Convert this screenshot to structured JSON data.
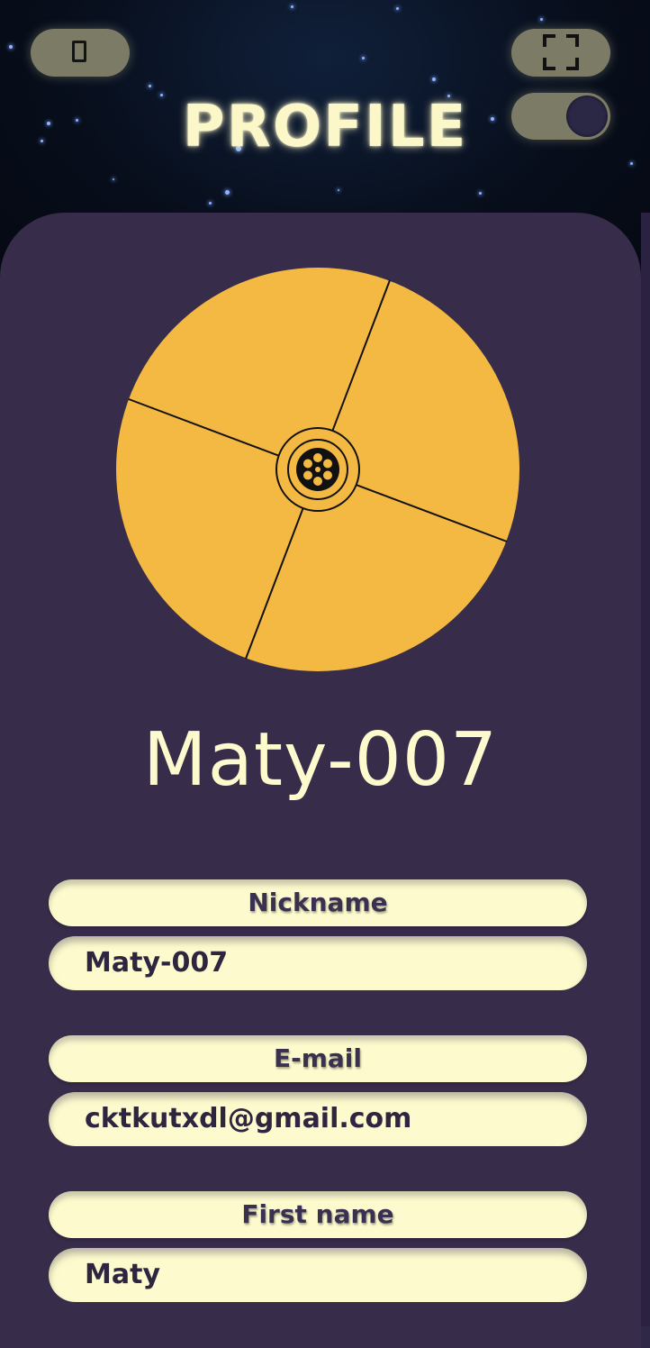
{
  "header": {
    "title": "PROFILE",
    "back_icon": "back-icon",
    "fullscreen_icon": "fullscreen-icon",
    "theme_toggle_state": "dark"
  },
  "profile": {
    "username": "Maty-007",
    "avatar_icon": "revolver-cylinder-icon",
    "avatar_color": "#f4b942"
  },
  "fields": [
    {
      "label": "Nickname",
      "value": "Maty-007"
    },
    {
      "label": "E-mail",
      "value": "cktkutxdl@gmail.com"
    },
    {
      "label": "First name",
      "value": "Maty"
    }
  ],
  "colors": {
    "background": "#372c49",
    "accent": "#fdfbcd",
    "button": "#7b7b66"
  }
}
